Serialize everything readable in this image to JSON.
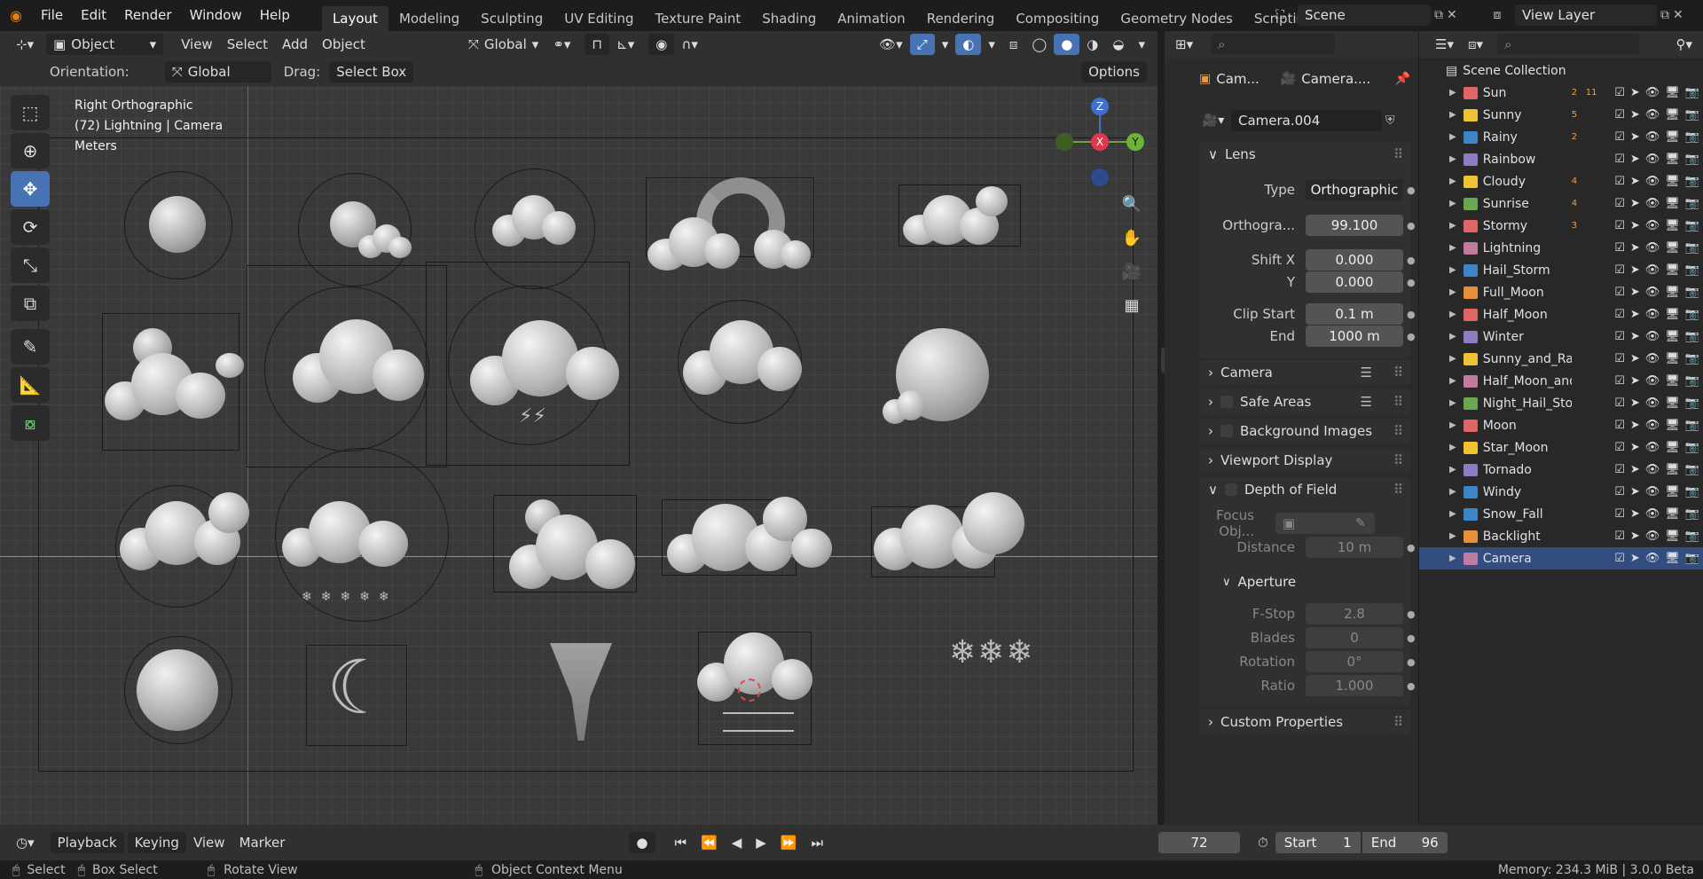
{
  "topbar": {
    "menus": [
      "File",
      "Edit",
      "Render",
      "Window",
      "Help"
    ],
    "workspaces": [
      "Layout",
      "Modeling",
      "Sculpting",
      "UV Editing",
      "Texture Paint",
      "Shading",
      "Animation",
      "Rendering",
      "Compositing",
      "Geometry Nodes",
      "Scripting"
    ],
    "active_workspace": "Layout",
    "scene": "Scene",
    "view_layer": "View Layer"
  },
  "viewport_header": {
    "mode": "Object Mode",
    "menus": [
      "View",
      "Select",
      "Add",
      "Object"
    ],
    "transform_orientation": "Global"
  },
  "tool_settings": {
    "orientation_label": "Orientation:",
    "orientation_value": "Global",
    "drag_label": "Drag:",
    "drag_value": "Select Box",
    "options": "Options"
  },
  "viewport_overlay": {
    "line1": "Right Orthographic",
    "line2": "(72) Lightning | Camera",
    "line3": "Meters"
  },
  "gizmo": {
    "z": "Z",
    "x": "X",
    "y": "Y"
  },
  "properties": {
    "header_object": "Cam...",
    "header_data": "Camera....",
    "datablock": "Camera.004",
    "lens_panel": "Lens",
    "type_label": "Type",
    "type_value": "Orthographic",
    "ortho_label": "Orthogra...",
    "ortho_value": "99.100",
    "shiftx_label": "Shift X",
    "shiftx_value": "0.000",
    "shifty_label": "Y",
    "shifty_value": "0.000",
    "clipstart_label": "Clip Start",
    "clipstart_value": "0.1 m",
    "clipend_label": "End",
    "clipend_value": "1000 m",
    "camera_panel": "Camera",
    "safe_areas_panel": "Safe Areas",
    "bg_images_panel": "Background Images",
    "viewport_display_panel": "Viewport Display",
    "dof_panel": "Depth of Field",
    "focus_label": "Focus Obj...",
    "distance_label": "Distance",
    "distance_value": "10 m",
    "aperture_panel": "Aperture",
    "fstop_label": "F-Stop",
    "fstop_value": "2.8",
    "blades_label": "Blades",
    "blades_value": "0",
    "rotation_label": "Rotation",
    "rotation_value": "0°",
    "ratio_label": "Ratio",
    "ratio_value": "1.000",
    "custom_props_panel": "Custom Properties"
  },
  "outliner": {
    "root": "Scene Collection",
    "items": [
      {
        "name": "Sun",
        "color": "#e06666",
        "badge": "2",
        "badge2": "11"
      },
      {
        "name": "Sunny",
        "color": "#f1c232",
        "badge": "5",
        "badge2": ""
      },
      {
        "name": "Rainy",
        "color": "#3d85c6",
        "badge": "2",
        "badge2": ""
      },
      {
        "name": "Rainbow",
        "color": "#8e7cc3",
        "badge": "",
        "badge2": ""
      },
      {
        "name": "Cloudy",
        "color": "#f1c232",
        "badge": "4",
        "badge2": ""
      },
      {
        "name": "Sunrise",
        "color": "#6aa84f",
        "badge": "4",
        "badge2": ""
      },
      {
        "name": "Stormy",
        "color": "#e06666",
        "badge": "3",
        "badge2": ""
      },
      {
        "name": "Lightning",
        "color": "#c27ba0",
        "badge": "",
        "badge2": ""
      },
      {
        "name": "Hail_Storm",
        "color": "#3d85c6",
        "badge": "",
        "badge2": ""
      },
      {
        "name": "Full_Moon",
        "color": "#e69138",
        "badge": "",
        "badge2": ""
      },
      {
        "name": "Half_Moon",
        "color": "#e06666",
        "badge": "",
        "badge2": ""
      },
      {
        "name": "Winter",
        "color": "#8e7cc3",
        "badge": "",
        "badge2": ""
      },
      {
        "name": "Sunny_and_Rain",
        "color": "#f1c232",
        "badge": "",
        "badge2": ""
      },
      {
        "name": "Half_Moon_and_",
        "color": "#c27ba0",
        "badge": "",
        "badge2": ""
      },
      {
        "name": "Night_Hail_Storm",
        "color": "#6aa84f",
        "badge": "",
        "badge2": ""
      },
      {
        "name": "Moon",
        "color": "#e06666",
        "badge": "",
        "badge2": ""
      },
      {
        "name": "Star_Moon",
        "color": "#f1c232",
        "badge": "",
        "badge2": ""
      },
      {
        "name": "Tornado",
        "color": "#8e7cc3",
        "badge": "",
        "badge2": ""
      },
      {
        "name": "Windy",
        "color": "#3d85c6",
        "badge": "",
        "badge2": ""
      },
      {
        "name": "Snow_Fall",
        "color": "#3d85c6",
        "badge": "",
        "badge2": ""
      },
      {
        "name": "Backlight",
        "color": "#e69138",
        "badge": "",
        "badge2": ""
      },
      {
        "name": "Camera",
        "color": "#c27ba0",
        "badge": "",
        "badge2": ""
      }
    ]
  },
  "timeline": {
    "playback": "Playback",
    "keying": "Keying",
    "view": "View",
    "marker": "Marker",
    "current_frame": "72",
    "start_label": "Start",
    "start_value": "1",
    "end_label": "End",
    "end_value": "96"
  },
  "statusbar": {
    "select": "Select",
    "box_select": "Box Select",
    "rotate_view": "Rotate View",
    "context_menu": "Object Context Menu",
    "memory": "Memory: 234.3 MiB | 3.0.0 Beta"
  }
}
